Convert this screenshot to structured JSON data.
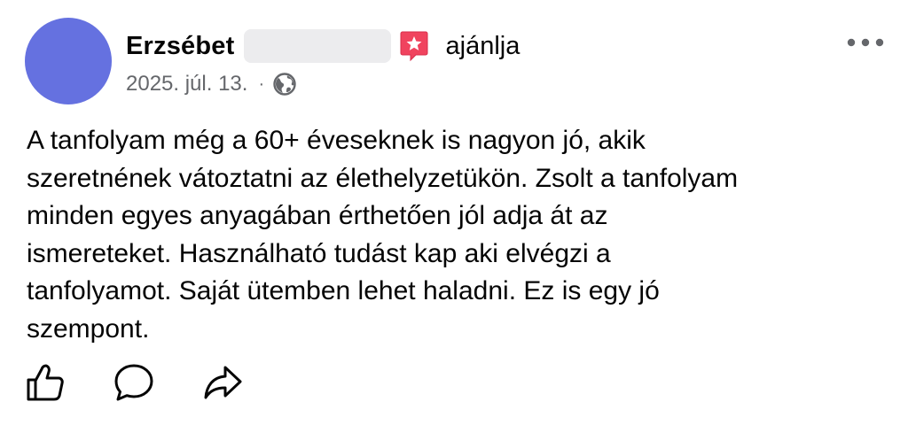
{
  "post": {
    "author_name": "Erzsébet",
    "recommend_text": "ajánlja",
    "date": "2025. júl. 13.",
    "separator": "·",
    "body": "A tanfolyam még a 60+ éveseknek is nagyon jó, akik\nszeretnének vátoztatni az élethelyzetükön. Zsolt a tanfolyam\nminden egyes anyagában érthetően jól adja át az\nismereteket. Használható tudást kap aki elvégzi a\ntanfolyamot. Saját ütemben lehet haladni. Ez is egy jó\nszempont."
  },
  "icons": {
    "recommend": "recommend-star-badge-icon",
    "privacy": "globe-icon",
    "more": "more-options-icon",
    "like": "thumbs-up-icon",
    "comment": "comment-bubble-icon",
    "share": "share-arrow-icon"
  },
  "colors": {
    "avatar": "#6571e0",
    "recommend_badge": "#f0435e",
    "secondary_text": "#65676b",
    "primary_text": "#050505"
  }
}
